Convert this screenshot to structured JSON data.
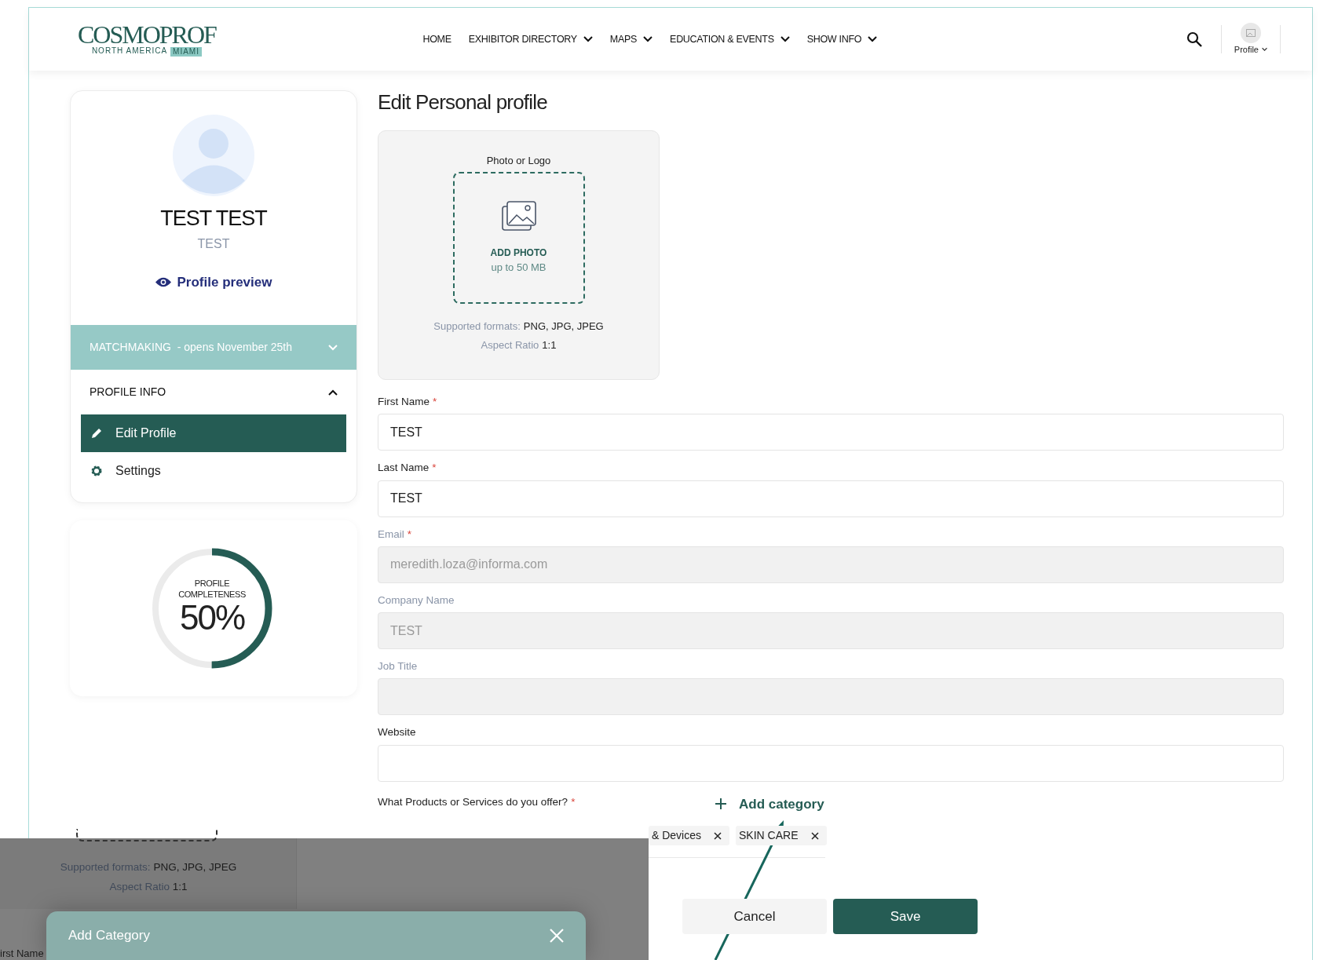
{
  "header": {
    "logo": {
      "title": "COSMOPROF",
      "subtitle": "NORTH AMERICA",
      "tag": "MIAMI"
    },
    "nav": [
      {
        "label": "HOME",
        "dropdown": false
      },
      {
        "label": "EXHIBITOR DIRECTORY",
        "dropdown": true
      },
      {
        "label": "MAPS",
        "dropdown": true
      },
      {
        "label": "EDUCATION & EVENTS",
        "dropdown": true
      },
      {
        "label": "SHOW INFO",
        "dropdown": true
      }
    ],
    "profile_label": "Profile"
  },
  "sidebar": {
    "name": "TEST TEST",
    "company": "TEST",
    "preview_link": "Profile preview",
    "sections": [
      {
        "label": "MATCHMAKING  - opens November 25th",
        "kind": "banner",
        "expanded": false
      },
      {
        "label": "PROFILE INFO",
        "kind": "group",
        "expanded": true,
        "items": [
          {
            "label": "Edit Profile",
            "kind": "edit",
            "selected": true
          },
          {
            "label": "Settings",
            "kind": "settings",
            "selected": false
          }
        ]
      }
    ]
  },
  "completeness": {
    "label": "PROFILE COMPLETENESS",
    "value": "50%",
    "level": 0.5
  },
  "form": {
    "title": "Edit Personal profile",
    "photo": {
      "label": "Photo or Logo",
      "action": "ADD PHOTO",
      "limit": "up to 50 MB",
      "formats_label": "Supported formats:",
      "formats": "PNG, JPG, JPEG",
      "ratio_label": "Aspect Ratio",
      "ratio": "1:1"
    },
    "fields": [
      {
        "label": "First Name",
        "required_mark": "*",
        "disabled": false,
        "value": "TEST"
      },
      {
        "label": "Last Name",
        "required_mark": "*",
        "disabled": false,
        "value": "TEST"
      },
      {
        "label": "Email",
        "required_mark": "*",
        "disabled": true,
        "value": "meredith.loza@informa.com"
      },
      {
        "label": "Company Name",
        "disabled": true,
        "value": "TEST"
      },
      {
        "label": "Job Title",
        "disabled": true
      },
      {
        "label": "Website",
        "disabled": false
      }
    ],
    "categories": {
      "label": "What Products or Services do you offer?",
      "required_mark": "*",
      "add": "Add category",
      "tags": [
        "& Devices",
        "SKIN CARE"
      ]
    },
    "buttons": [
      {
        "label": "Cancel",
        "kind": "secondary"
      },
      {
        "label": "Save",
        "kind": "primary"
      }
    ]
  },
  "overlay": {
    "formats_label": "Supported formats:",
    "formats": "PNG, JPG, JPEG",
    "ratio_label": "Aspect Ratio",
    "ratio": "1:1",
    "field_label": "irst Name",
    "modal_title": "Add Category"
  }
}
